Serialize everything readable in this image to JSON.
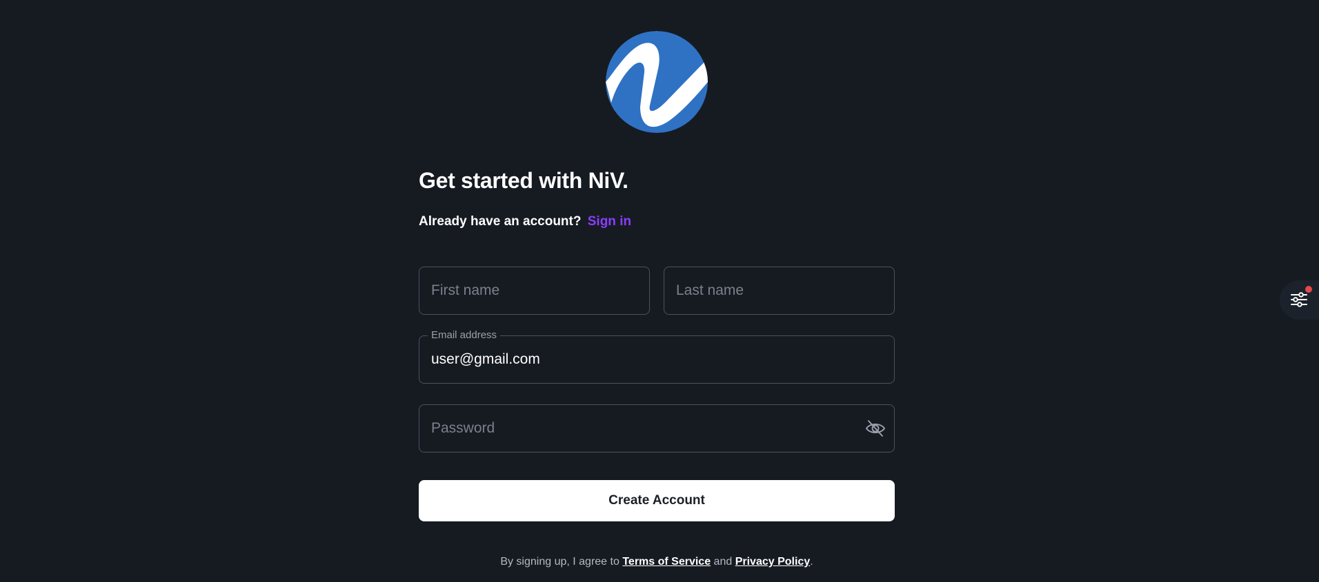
{
  "brand": {
    "logo_icon": "niv-logo-icon",
    "logo_bg_color": "#2f72c3"
  },
  "header": {
    "title": "Get started with NiV.",
    "subtitle": "Already have an account?",
    "signin_label": "Sign in"
  },
  "form": {
    "first_name": {
      "placeholder": "First name",
      "value": ""
    },
    "last_name": {
      "placeholder": "Last name",
      "value": ""
    },
    "email": {
      "label": "Email address",
      "value": "user@gmail.com"
    },
    "password": {
      "placeholder": "Password",
      "value": "",
      "toggle_icon": "eye-off-icon"
    },
    "submit_label": "Create Account"
  },
  "footer": {
    "prefix": "By signing up, I agree to",
    "terms_label": "Terms of Service",
    "and_label": "and",
    "privacy_label": "Privacy Policy",
    "suffix": "."
  },
  "floating_button": {
    "icon": "sliders-icon",
    "badge_color": "#e5484d"
  },
  "colors": {
    "background": "#161b22",
    "accent": "#8b3dff",
    "field_border": "#4a5261"
  }
}
